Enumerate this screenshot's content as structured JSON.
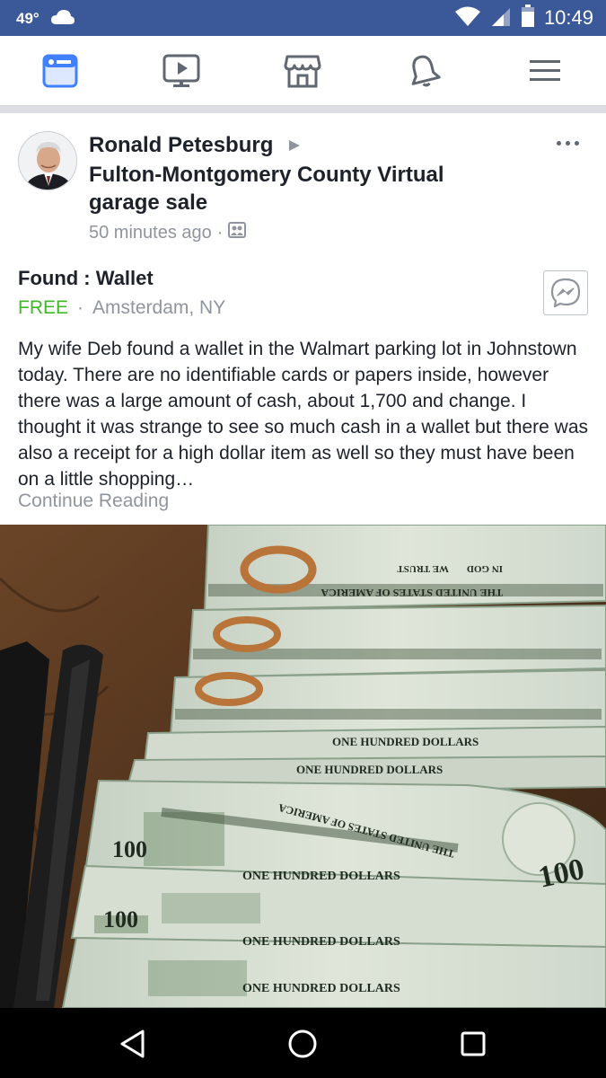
{
  "status_bar": {
    "temperature": "49°",
    "weather_icon": "cloud-icon",
    "time": "10:49",
    "icons": [
      "wifi-icon",
      "signal-icon",
      "battery-icon"
    ]
  },
  "nav_tabs": [
    {
      "name": "news-feed",
      "icon": "news-feed-icon",
      "active": true
    },
    {
      "name": "watch",
      "icon": "video-icon",
      "active": false
    },
    {
      "name": "marketplace",
      "icon": "marketplace-icon",
      "active": false
    },
    {
      "name": "notifications",
      "icon": "bell-icon",
      "active": false
    },
    {
      "name": "menu",
      "icon": "menu-icon",
      "active": false
    }
  ],
  "post": {
    "author": "Ronald Petesburg",
    "group": "Fulton-Montgomery County Virtual garage sale",
    "time": "50 minutes ago",
    "meta_separator": "·",
    "listing_title": "Found : Wallet",
    "price": "FREE",
    "price_separator": "·",
    "location": "Amsterdam, NY",
    "body": "My wife Deb found a wallet in the Walmart parking lot in Johnstown today. There are no identifiable cards or papers inside, however there was a large amount of cash, about 1,700 and change. I thought it was strange to see so much cash in a wallet but there was also a receipt for a high dollar item as well so they must have been on a little shopping…",
    "continue_label": "Continue Reading",
    "photo_icon": "photo-of-hundred-dollar-bills"
  },
  "bill_text": {
    "in_god": "IN GOD",
    "we_trust": "WE TRUST",
    "usa": "THE UNITED STATES OF AMERICA",
    "one_hundred": "ONE HUNDRED DOLLARS",
    "denomination": "100"
  },
  "colors": {
    "status_bar": "#3b5998",
    "accent": "#4080ff",
    "price": "#42b72a",
    "secondary_text": "#90949c"
  },
  "system_nav": [
    "back-icon",
    "home-icon",
    "recents-icon"
  ]
}
